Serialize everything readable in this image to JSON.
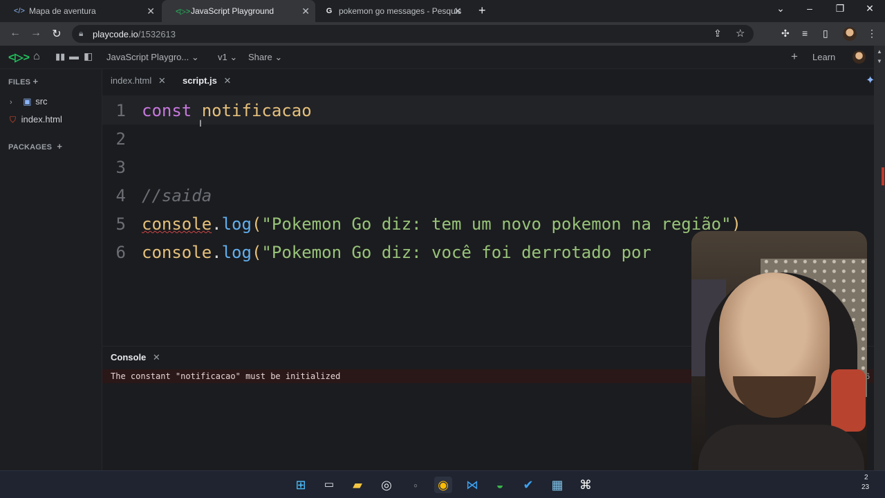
{
  "browser": {
    "tabs": [
      {
        "title": "Mapa de aventura",
        "favicon": "code-icon"
      },
      {
        "title": "JavaScript Playground",
        "favicon": "playcode-icon"
      },
      {
        "title": "pokemon go messages - Pesquis",
        "favicon": "google-icon"
      }
    ],
    "new_tab": "+",
    "url_host": "playcode.io",
    "url_path": "/1532613"
  },
  "app": {
    "project_name": "JavaScript Playgro...",
    "version": "v1",
    "share": "Share",
    "learn": "Learn"
  },
  "sidebar": {
    "files_header": "FILES",
    "items": [
      {
        "label": "src",
        "icon": "folder-icon"
      },
      {
        "label": "index.html",
        "icon": "html5-icon"
      }
    ],
    "packages_header": "PACKAGES"
  },
  "editor": {
    "tabs": [
      {
        "label": "index.html"
      },
      {
        "label": "script.js"
      }
    ],
    "lines": [
      {
        "num": "1",
        "parts": [
          "const",
          " ",
          "notificacao"
        ]
      },
      {
        "num": "2"
      },
      {
        "num": "3"
      },
      {
        "num": "4",
        "comment": "//saida"
      },
      {
        "num": "5",
        "obj": "console",
        "dot": ".",
        "method": "log",
        "open": "(",
        "str": "\"Pokemon Go diz: tem um novo pokemon na região\"",
        "close": ")"
      },
      {
        "num": "6",
        "obj": "console",
        "dot": ".",
        "method": "log",
        "open": "(",
        "str": "\"Pokemon Go diz: você foi derrotado por"
      }
    ]
  },
  "console": {
    "title": "Console",
    "error": "The constant \"notificacao\" must be initialized",
    "line_ref": ":6"
  },
  "taskbar": {
    "clock_line1": "2",
    "clock_line2": "23"
  },
  "colors": {
    "keyword": "#c678dd",
    "variable": "#e5c07b",
    "string": "#98c379",
    "method": "#61afef",
    "accent": "#22c55e"
  }
}
